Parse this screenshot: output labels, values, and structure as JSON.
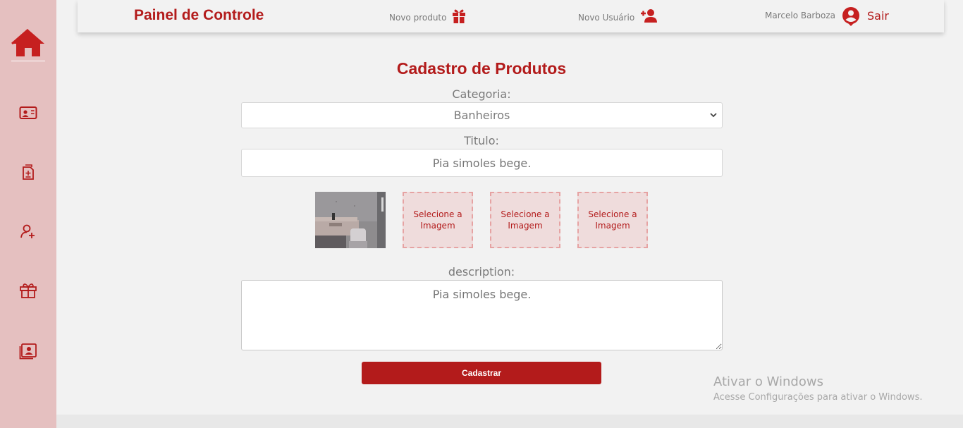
{
  "topbar": {
    "brand": "Painel de Controle",
    "new_product": "Novo produto",
    "new_user": "Novo Usuário",
    "user_name": "Marcelo Barboza",
    "logout": "Sair"
  },
  "sidebar": {
    "items": [
      "home-icon",
      "contact-card-icon",
      "add-document-icon",
      "add-user-icon",
      "gift-icon",
      "user-badge-icon"
    ]
  },
  "form": {
    "title": "Cadastro de Produtos",
    "category_label": "Categoria:",
    "category_value": "Banheiros",
    "title_label": "Titulo:",
    "title_placeholder": "Pia simoles bege.",
    "image_slot_label": "Selecione a Imagem",
    "description_label": "description:",
    "description_placeholder": "Pia simoles bege.",
    "submit_label": "Cadastrar"
  },
  "watermark": {
    "title": "Ativar o Windows",
    "subtitle": "Acesse Configurações para ativar o Windows."
  },
  "colors": {
    "accent": "#b31b1b",
    "sidebar": "#e5c0c0",
    "background": "#f2f2f2"
  }
}
